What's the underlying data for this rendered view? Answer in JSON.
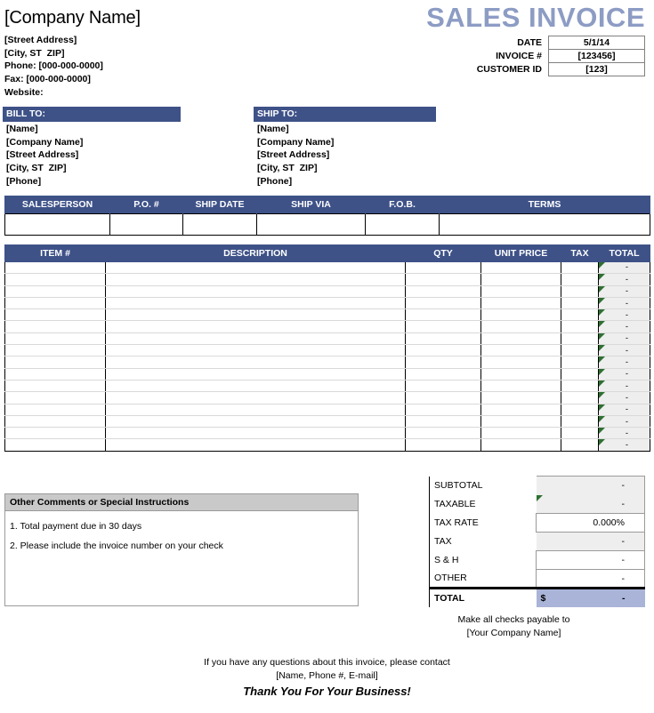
{
  "header": {
    "company_name": "[Company Name]",
    "address_lines": [
      "[Street Address]",
      "[City, ST  ZIP]",
      "Phone: [000-000-0000]",
      "Fax: [000-000-0000]",
      "Website:"
    ],
    "title": "SALES INVOICE",
    "meta": [
      {
        "label": "DATE",
        "value": "5/1/14"
      },
      {
        "label": "INVOICE #",
        "value": "[123456]"
      },
      {
        "label": "CUSTOMER ID",
        "value": "[123]"
      }
    ]
  },
  "bill_to": {
    "heading": "BILL TO:",
    "lines": [
      "[Name]",
      "[Company Name]",
      "[Street Address]",
      "[City, ST  ZIP]",
      "[Phone]"
    ]
  },
  "ship_to": {
    "heading": "SHIP TO:",
    "lines": [
      "[Name]",
      "[Company Name]",
      "[Street Address]",
      "[City, ST  ZIP]",
      "[Phone]"
    ]
  },
  "sales_strip": {
    "columns": [
      "SALESPERSON",
      "P.O. #",
      "SHIP DATE",
      "SHIP VIA",
      "F.O.B.",
      "TERMS"
    ],
    "values": [
      "",
      "",
      "",
      "",
      "",
      ""
    ]
  },
  "items": {
    "columns": [
      "ITEM #",
      "DESCRIPTION",
      "QTY",
      "UNIT PRICE",
      "TAX",
      "TOTAL"
    ],
    "rows": [
      {
        "item": "",
        "description": "",
        "qty": "",
        "unit_price": "",
        "tax": "",
        "total": "-"
      },
      {
        "item": "",
        "description": "",
        "qty": "",
        "unit_price": "",
        "tax": "",
        "total": "-"
      },
      {
        "item": "",
        "description": "",
        "qty": "",
        "unit_price": "",
        "tax": "",
        "total": "-"
      },
      {
        "item": "",
        "description": "",
        "qty": "",
        "unit_price": "",
        "tax": "",
        "total": "-"
      },
      {
        "item": "",
        "description": "",
        "qty": "",
        "unit_price": "",
        "tax": "",
        "total": "-"
      },
      {
        "item": "",
        "description": "",
        "qty": "",
        "unit_price": "",
        "tax": "",
        "total": "-"
      },
      {
        "item": "",
        "description": "",
        "qty": "",
        "unit_price": "",
        "tax": "",
        "total": "-"
      },
      {
        "item": "",
        "description": "",
        "qty": "",
        "unit_price": "",
        "tax": "",
        "total": "-"
      },
      {
        "item": "",
        "description": "",
        "qty": "",
        "unit_price": "",
        "tax": "",
        "total": "-"
      },
      {
        "item": "",
        "description": "",
        "qty": "",
        "unit_price": "",
        "tax": "",
        "total": "-"
      },
      {
        "item": "",
        "description": "",
        "qty": "",
        "unit_price": "",
        "tax": "",
        "total": "-"
      },
      {
        "item": "",
        "description": "",
        "qty": "",
        "unit_price": "",
        "tax": "",
        "total": "-"
      },
      {
        "item": "",
        "description": "",
        "qty": "",
        "unit_price": "",
        "tax": "",
        "total": "-"
      },
      {
        "item": "",
        "description": "",
        "qty": "",
        "unit_price": "",
        "tax": "",
        "total": "-"
      },
      {
        "item": "",
        "description": "",
        "qty": "",
        "unit_price": "",
        "tax": "",
        "total": "-"
      },
      {
        "item": "",
        "description": "",
        "qty": "",
        "unit_price": "",
        "tax": "",
        "total": "-"
      }
    ]
  },
  "comments": {
    "heading": "Other Comments or Special Instructions",
    "lines": [
      "1. Total payment due in 30 days",
      "2. Please include the invoice number on your check"
    ]
  },
  "summary": {
    "rows": [
      {
        "label": "SUBTOTAL",
        "dollar": "",
        "value": "-",
        "fill": "grey",
        "flag": false
      },
      {
        "label": "TAXABLE",
        "dollar": "",
        "value": "-",
        "fill": "grey",
        "flag": true
      },
      {
        "label": "TAX RATE",
        "dollar": "",
        "value": "0.000%",
        "fill": "white",
        "flag": false
      },
      {
        "label": "TAX",
        "dollar": "",
        "value": "-",
        "fill": "grey",
        "flag": false
      },
      {
        "label": "S & H",
        "dollar": "",
        "value": "-",
        "fill": "white",
        "flag": false
      },
      {
        "label": "OTHER",
        "dollar": "",
        "value": "-",
        "fill": "white",
        "flag": false
      }
    ],
    "total": {
      "label": "TOTAL",
      "dollar": "$",
      "value": "-"
    }
  },
  "footer": {
    "payable_line1": "Make all checks payable to",
    "payable_line2": "[Your Company Name]",
    "contact_line1": "If you have any questions about this invoice, please contact",
    "contact_line2": "[Name, Phone #, E-mail]",
    "thanks": "Thank You For Your Business!"
  },
  "colors": {
    "header_blue": "#3e5288",
    "title_blue": "#8d9cc4",
    "total_row_blue": "#aab4d8",
    "cell_grey": "#eeeeee",
    "comments_head_grey": "#c9c9c9",
    "flag_green": "#2e7031"
  }
}
